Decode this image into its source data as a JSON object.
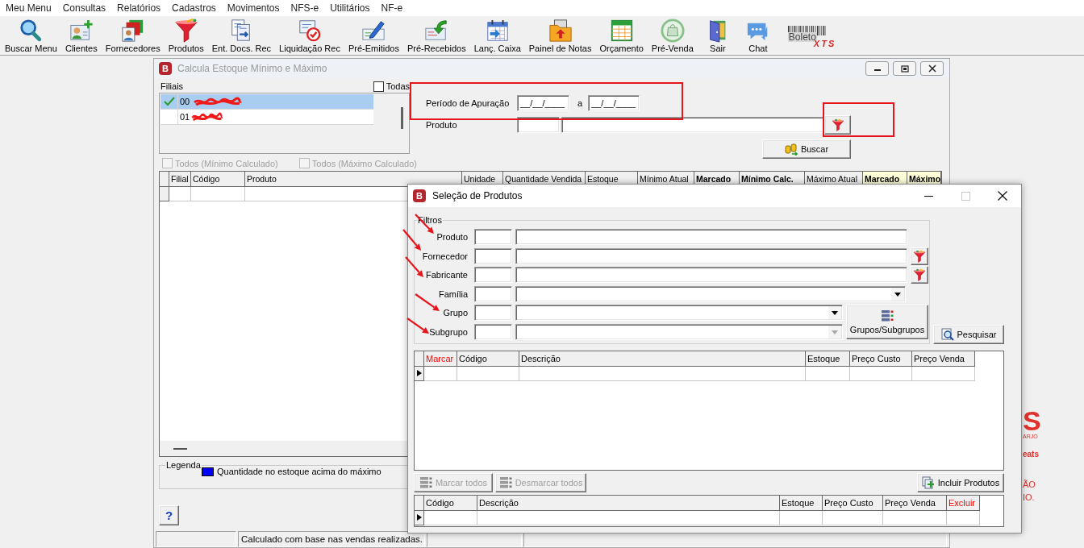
{
  "menu_bar": {
    "items": [
      "Meu Menu",
      "Consultas",
      "Relatórios",
      "Cadastros",
      "Movimentos",
      "NFS-e",
      "Utilitários",
      "NF-e"
    ]
  },
  "toolbar": {
    "items": [
      {
        "kind": "button",
        "label": "Buscar Menu"
      },
      {
        "kind": "button",
        "label": "Clientes"
      },
      {
        "kind": "button",
        "label": "Fornecedores"
      },
      {
        "kind": "button",
        "label": "Produtos"
      },
      {
        "kind": "button",
        "label": "Ent. Docs. Rec"
      },
      {
        "kind": "button",
        "label": "Liquidação Rec"
      },
      {
        "kind": "button",
        "label": "Pré-Emitidos"
      },
      {
        "kind": "button",
        "label": "Pré-Recebidos"
      },
      {
        "kind": "button",
        "label": "Lanç. Caixa"
      },
      {
        "kind": "button",
        "label": "Painel de Notas"
      },
      {
        "kind": "button",
        "label": "Orçamento"
      },
      {
        "kind": "button",
        "label": "Pré-Venda"
      },
      {
        "kind": "button",
        "label": "Sair"
      },
      {
        "kind": "button",
        "label": "Chat"
      },
      {
        "kind": "logo",
        "label": "Boleto",
        "mark": "XTS"
      }
    ]
  },
  "main_window": {
    "logo": "B",
    "title": "Calcula Estoque Mínimo e Máximo",
    "branches": {
      "label": "Filiais",
      "all_label": "Todas",
      "all_checked": false,
      "items": [
        {
          "code": "00",
          "checked": true,
          "selected": true,
          "redacted": true
        },
        {
          "code": "01",
          "checked": false,
          "selected": false,
          "redacted": true
        }
      ]
    },
    "period": {
      "label": "Período de Apuração",
      "from": "__/__/____",
      "separator": "a",
      "to": "__/__/____",
      "annotated": true
    },
    "product": {
      "label": "Produto",
      "annotated": true
    },
    "search_button": "Buscar",
    "options": [
      {
        "label": "Todos (Mínimo Calculado)",
        "checked": false,
        "disabled": true
      },
      {
        "label": "Todos (Máximo Calculado)",
        "checked": false,
        "disabled": true
      }
    ],
    "table": {
      "columns": [
        {
          "label": "Filial",
          "bold": false,
          "highlighted": false
        },
        {
          "label": "Código",
          "bold": false,
          "highlighted": false
        },
        {
          "label": "Produto",
          "bold": false,
          "highlighted": false
        },
        {
          "label": "Unidade",
          "bold": false,
          "highlighted": false
        },
        {
          "label": "Quantidade Vendida",
          "bold": false,
          "highlighted": false
        },
        {
          "label": "Estoque",
          "bold": false,
          "highlighted": false
        },
        {
          "label": "Mínimo Atual",
          "bold": false,
          "highlighted": false
        },
        {
          "label": "Marcado",
          "bold": true,
          "highlighted": false
        },
        {
          "label": "Mínimo Calc.",
          "bold": true,
          "highlighted": false
        },
        {
          "label": "Máximo Atual",
          "bold": false,
          "highlighted": false
        },
        {
          "label": "Marcado",
          "bold": true,
          "highlighted": true
        },
        {
          "label": "Máximo",
          "bold": true,
          "highlighted": true
        }
      ]
    },
    "legend": {
      "title": "Legenda",
      "items": [
        {
          "label": "Quantidade no estoque acima do máximo",
          "color": "#0000ff"
        }
      ]
    },
    "help_button": "?",
    "status_bar": {
      "message": "Calculado com base nas vendas realizadas."
    }
  },
  "dialog": {
    "logo": "B",
    "title": "Seleção de Produtos",
    "filters": {
      "title": "Filtros",
      "rows": [
        {
          "kind": "text",
          "label": "Produto",
          "annotated": true
        },
        {
          "kind": "lookup",
          "label": "Fornecedor",
          "annotated": true
        },
        {
          "kind": "lookup",
          "label": "Fabricante",
          "annotated": true
        },
        {
          "kind": "combo",
          "label": "Família",
          "disabled": false,
          "annotated": false
        },
        {
          "kind": "combo",
          "label": "Grupo",
          "disabled": false,
          "annotated": true
        },
        {
          "kind": "combo",
          "label": "Subgrupo",
          "disabled": true,
          "annotated": true
        }
      ]
    },
    "groups_button": "Grupos/Subgrupos",
    "search_button": "Pesquisar",
    "results_table": {
      "columns": [
        {
          "label": "Marcar",
          "color": "#ff0000"
        },
        {
          "label": "Código"
        },
        {
          "label": "Descrição"
        },
        {
          "label": "Estoque"
        },
        {
          "label": "Preço Custo"
        },
        {
          "label": "Preço Venda"
        }
      ]
    },
    "actions": [
      {
        "label": "Marcar todos",
        "disabled": true
      },
      {
        "label": "Desmarcar todos",
        "disabled": true
      }
    ],
    "include_button": "Incluir Produtos",
    "selected_table": {
      "columns": [
        {
          "label": "Código"
        },
        {
          "label": "Descrição"
        },
        {
          "label": "Estoque"
        },
        {
          "label": "Preço Custo"
        },
        {
          "label": "Preço Venda"
        },
        {
          "label": "Excluir",
          "color": "#ff0000"
        }
      ]
    }
  },
  "background_logo": {
    "fragments": [
      "S",
      "ARJO",
      "eats",
      "ÃO",
      "IO."
    ]
  }
}
